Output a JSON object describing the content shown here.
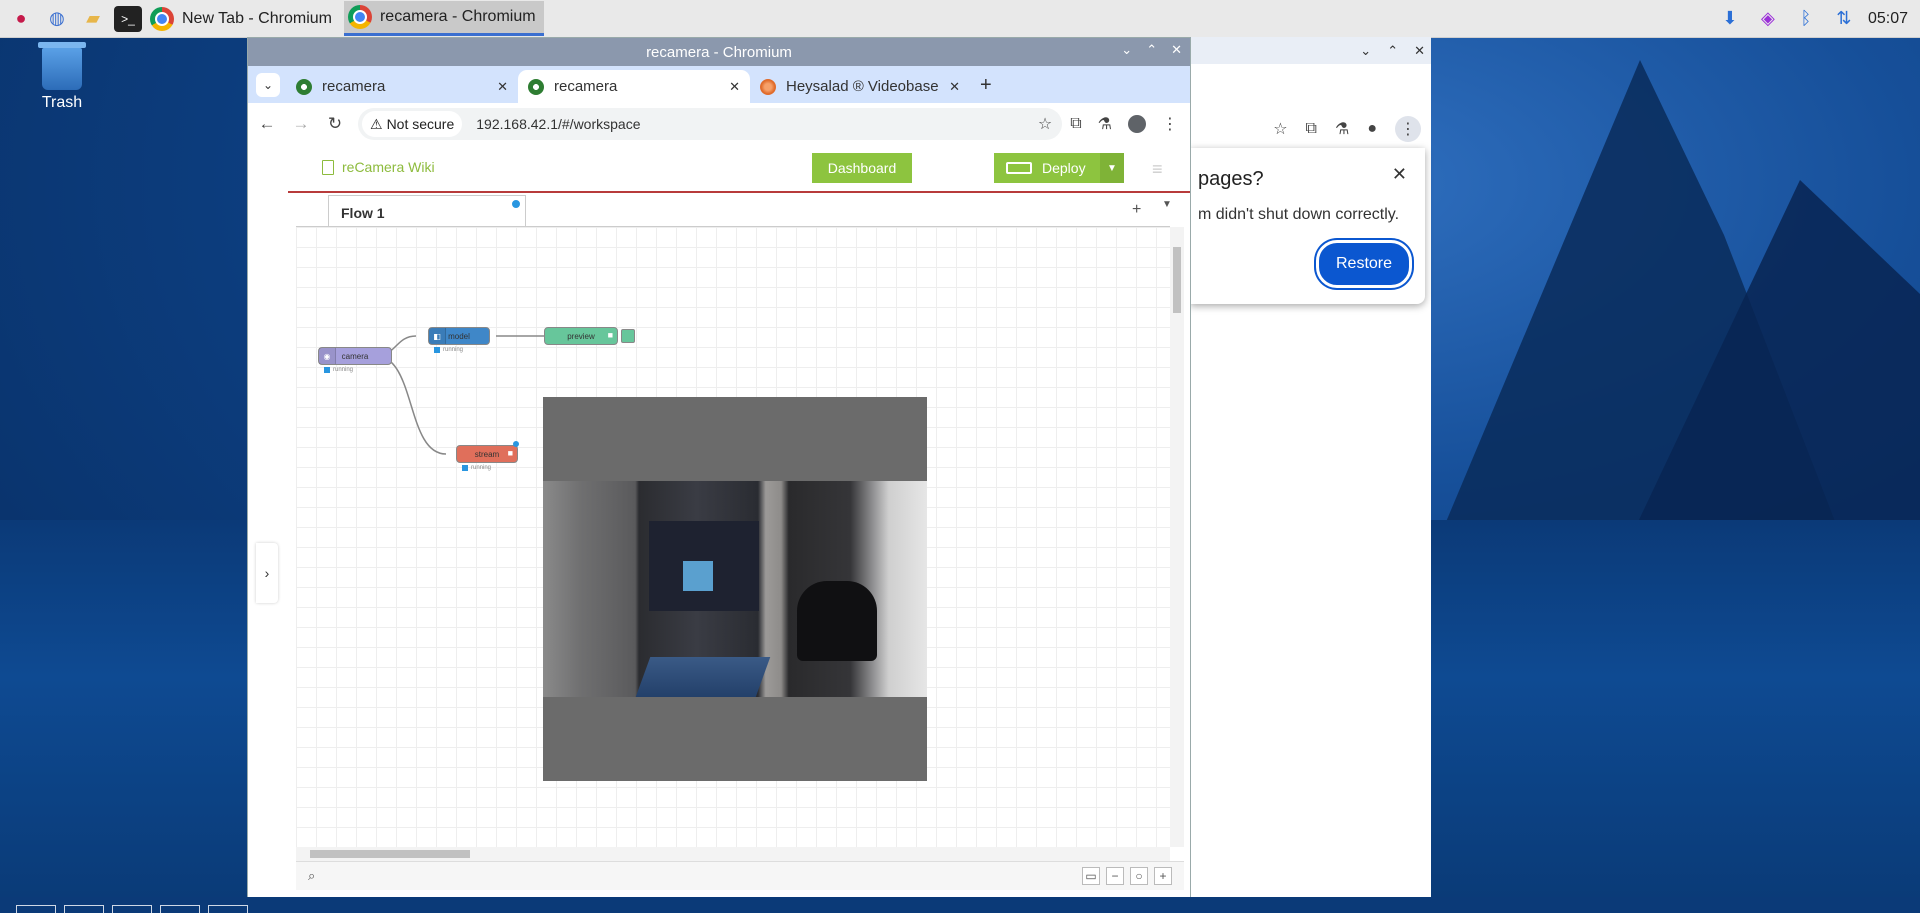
{
  "taskbar": {
    "tasks": [
      {
        "label": "New Tab - Chromium",
        "active": false
      },
      {
        "label": "recamera - Chromium",
        "active": true
      }
    ],
    "clock": "05:07"
  },
  "desktop": {
    "trash_label": "Trash"
  },
  "background_window": {
    "restore_prompt": {
      "title": "pages?",
      "message": "m didn't shut down correctly.",
      "button": "Restore"
    }
  },
  "browser": {
    "window_title": "recamera - Chromium",
    "tabs": [
      {
        "label": "recamera",
        "active": false
      },
      {
        "label": "recamera",
        "active": true
      },
      {
        "label": "Heysalad ® Videobase",
        "active": false
      }
    ],
    "omnibox": {
      "security": "Not secure",
      "url": "192.168.42.1/#/workspace"
    }
  },
  "app": {
    "wiki_link": "reCamera Wiki",
    "dashboard_button": "Dashboard",
    "deploy_button": "Deploy",
    "flow_tab": "Flow 1",
    "nodes": [
      {
        "label": "camera",
        "status": "running",
        "color": "#a6a0dc"
      },
      {
        "label": "model",
        "status": "running",
        "color": "#3f87c8"
      },
      {
        "label": "preview",
        "status": "",
        "color": "#67c69b"
      },
      {
        "label": "stream",
        "status": "running",
        "color": "#e06f5b"
      }
    ]
  },
  "colors": {
    "accent_green": "#8dc43f",
    "header_rule": "#b83b3b",
    "chrome_tabstrip": "#d3e3fd",
    "restore_button": "#0b57d0"
  }
}
